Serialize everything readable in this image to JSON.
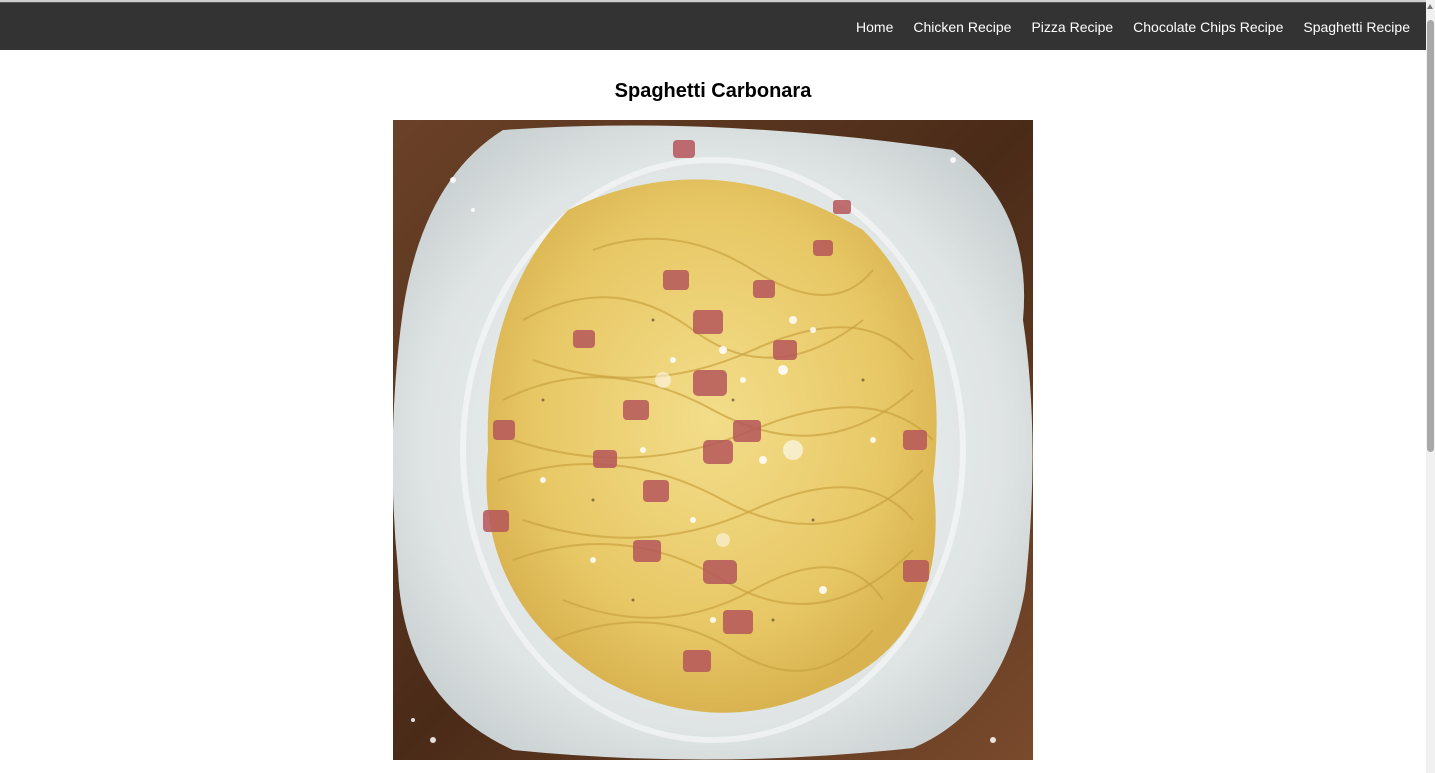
{
  "nav": {
    "items": [
      {
        "label": "Home"
      },
      {
        "label": "Chicken Recipe"
      },
      {
        "label": "Pizza Recipe"
      },
      {
        "label": "Chocolate Chips Recipe"
      },
      {
        "label": "Spaghetti Recipe"
      }
    ]
  },
  "main": {
    "title": "Spaghetti Carbonara",
    "image_alt": "spaghetti-carbonara-photo"
  },
  "colors": {
    "navbar": "#333333",
    "nav_text": "#ffffff",
    "background": "#ffffff"
  }
}
